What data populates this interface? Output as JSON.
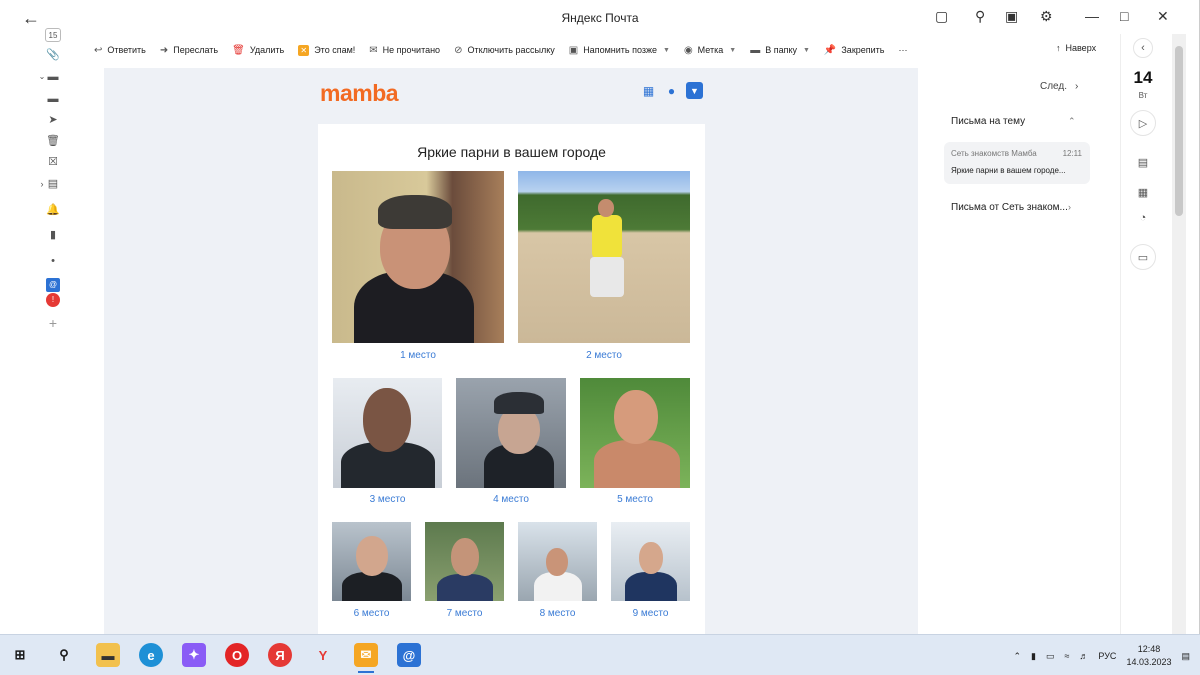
{
  "window": {
    "title": "Яндекс Почта"
  },
  "left_rail": {
    "badge_count": "15"
  },
  "toolbar": {
    "reply": "Ответить",
    "forward": "Переслать",
    "delete": "Удалить",
    "spam": "Это спам!",
    "unread": "Не прочитано",
    "unsubscribe": "Отключить рассылку",
    "remind": "Напомнить позже",
    "label": "Метка",
    "folder": "В папку",
    "pin": "Закрепить",
    "more": "···",
    "up": "Наверх"
  },
  "email": {
    "brand": "mamba",
    "heading": "Яркие парни в вашем городе",
    "places": [
      "1 место",
      "2 место",
      "3 место",
      "4 место",
      "5 место",
      "6 место",
      "7 место",
      "8 место",
      "9 место"
    ]
  },
  "right_panel": {
    "next": "След.",
    "thread_header": "Письма на тему",
    "thread_from": "Сеть знакомств Мамба",
    "thread_time": "12:11",
    "thread_subject": "Яркие парни в вашем городе...",
    "from_sender": "Письма от Сеть знаком..."
  },
  "calendar": {
    "day": "14",
    "weekday": "Вт"
  },
  "taskbar": {
    "lang": "РУС",
    "time": "12:48",
    "date": "14.03.2023"
  },
  "colors": {
    "brand": "#f26a22",
    "link": "#3a7bd5",
    "mail_bg": "#eef1f6"
  }
}
